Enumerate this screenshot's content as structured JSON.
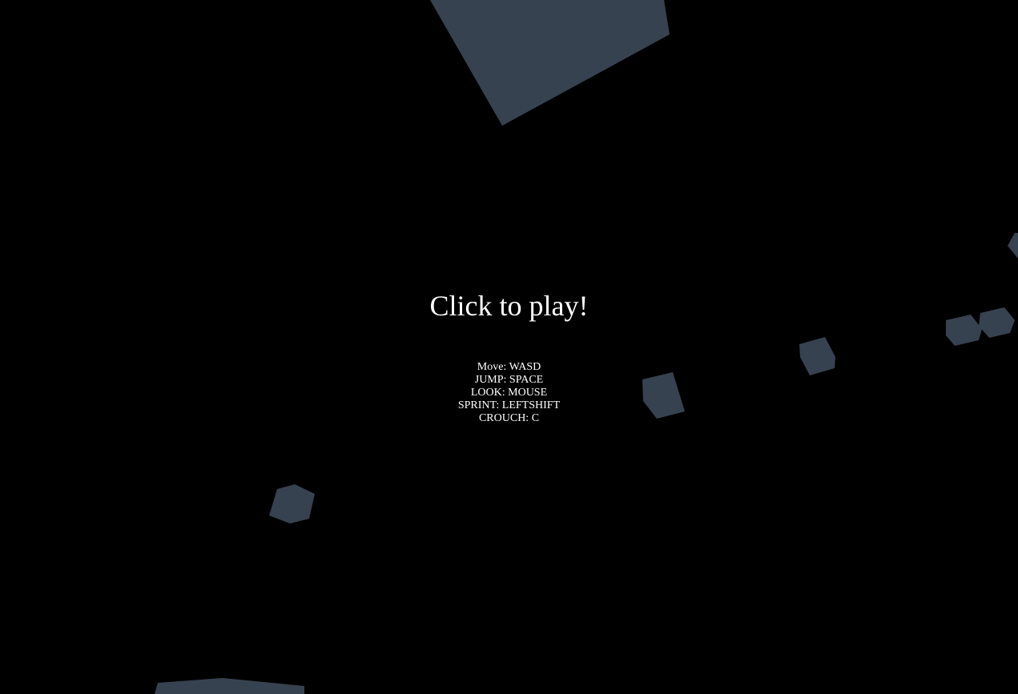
{
  "overlay": {
    "title": "Click to play!",
    "controls": [
      "Move: WASD",
      "JUMP: SPACE",
      "LOOK: MOUSE",
      "SPRINT: LEFTSHIFT",
      "CROUCH: C"
    ]
  },
  "colors": {
    "background": "#000000",
    "block_fill": "#374250",
    "text": "#ffffff"
  },
  "scene": {
    "block_count": 8,
    "block_icon": "floating-block-shape"
  }
}
